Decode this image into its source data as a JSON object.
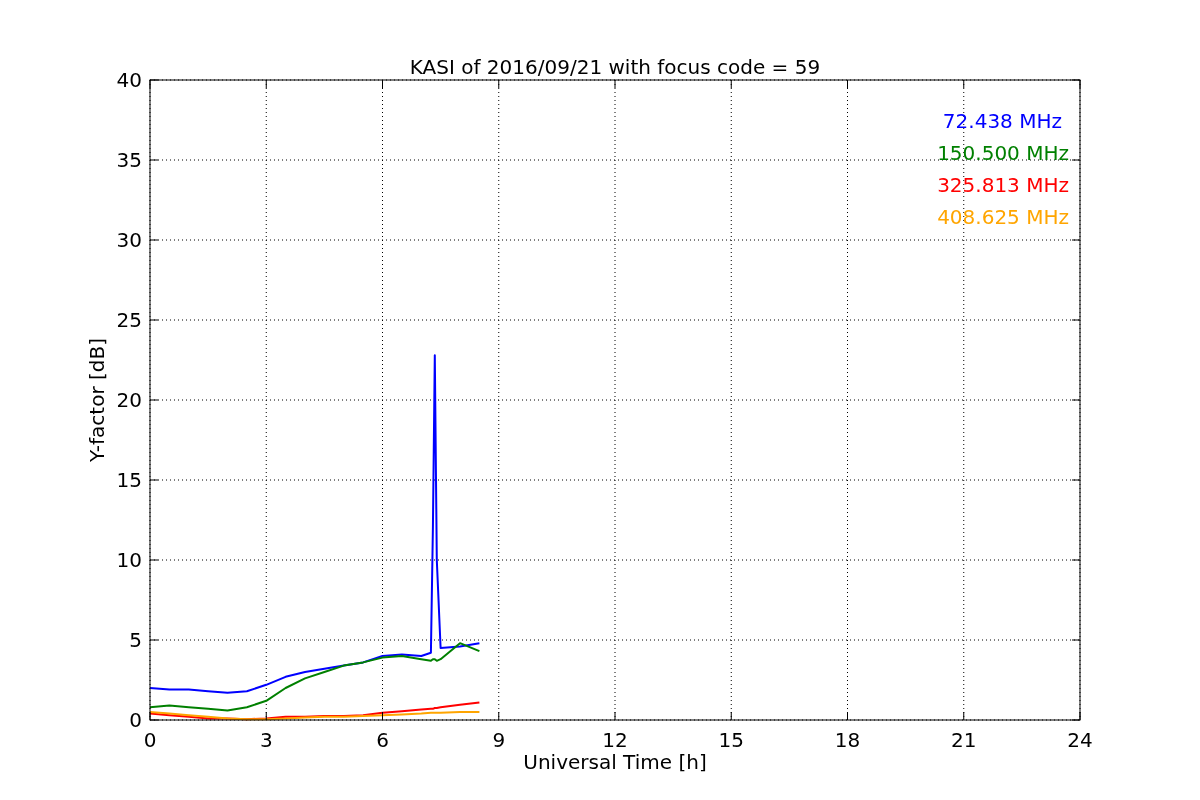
{
  "figure": {
    "chart_data": {
      "type": "line",
      "title": "KASI of 2016/09/21 with focus code = 59",
      "xlabel": "Universal Time [h]",
      "ylabel": "Y-factor [dB]",
      "x": [
        0,
        0.5,
        1,
        1.5,
        2,
        2.5,
        3,
        3.5,
        4,
        4.5,
        5,
        5.5,
        6,
        6.5,
        7,
        7.25,
        7.3,
        7.35,
        7.4,
        7.5,
        8,
        8.5
      ],
      "series": [
        {
          "name": "72.438 MHz",
          "color": "#0000ff",
          "values": [
            2.0,
            1.9,
            1.9,
            1.8,
            1.7,
            1.8,
            2.2,
            2.7,
            3.0,
            3.2,
            3.4,
            3.6,
            4.0,
            4.1,
            4.0,
            4.2,
            12,
            22.8,
            10,
            4.5,
            4.6,
            4.8
          ]
        },
        {
          "name": "150.500 MHz",
          "color": "#008000",
          "values": [
            0.8,
            0.9,
            0.8,
            0.7,
            0.6,
            0.8,
            1.2,
            2.0,
            2.6,
            3.0,
            3.4,
            3.6,
            3.9,
            4.0,
            3.8,
            3.7,
            3.8,
            3.8,
            3.7,
            3.8,
            4.8,
            4.3
          ]
        },
        {
          "name": "325.813 MHz",
          "color": "#ff0000",
          "values": [
            0.4,
            0.3,
            0.2,
            0.1,
            0.1,
            0.05,
            0.1,
            0.2,
            0.2,
            0.25,
            0.25,
            0.3,
            0.45,
            0.55,
            0.65,
            0.7,
            0.7,
            0.75,
            0.75,
            0.8,
            0.95,
            1.1
          ]
        },
        {
          "name": "408.625 MHz",
          "color": "#ffa500",
          "values": [
            0.5,
            0.4,
            0.3,
            0.2,
            0.1,
            0.05,
            0.05,
            0.1,
            0.15,
            0.2,
            0.2,
            0.25,
            0.3,
            0.35,
            0.4,
            0.45,
            0.45,
            0.45,
            0.45,
            0.45,
            0.5,
            0.5
          ]
        }
      ],
      "xlim": [
        0,
        24
      ],
      "ylim": [
        0,
        40
      ],
      "xticks": [
        0,
        3,
        6,
        9,
        12,
        15,
        18,
        21,
        24
      ],
      "yticks": [
        0,
        5,
        10,
        15,
        20,
        25,
        30,
        35,
        40
      ],
      "grid": true
    }
  }
}
